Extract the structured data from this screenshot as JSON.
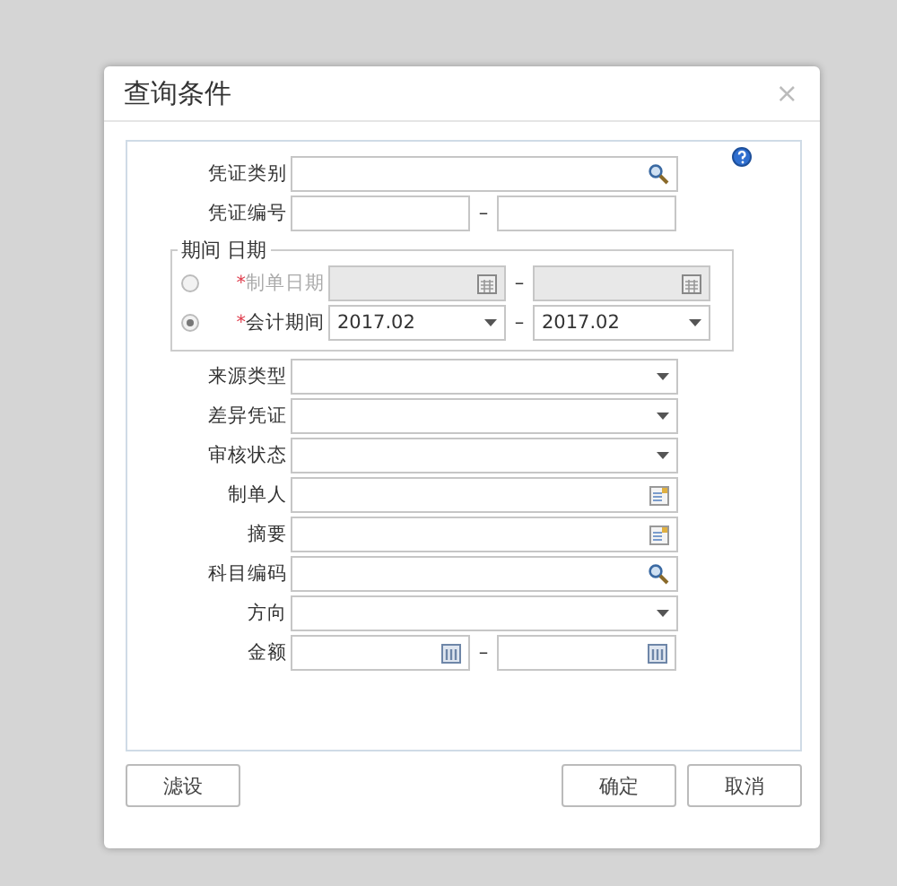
{
  "dialog": {
    "title": "查询条件",
    "close": "×"
  },
  "fields_top": [
    {
      "label": "凭证类别",
      "kind": "lookup"
    },
    {
      "label": "凭证编号",
      "kind": "text-range",
      "separator": "–"
    }
  ],
  "date_group": {
    "title": "期间 日期",
    "options": [
      {
        "label": "制单日期",
        "required_mark": "*",
        "selected": false,
        "disabled": true,
        "kind": "date",
        "separator": "–"
      },
      {
        "label": "会计期间",
        "required_mark": "*",
        "selected": true,
        "disabled": false,
        "kind": "period",
        "from": "2017.02",
        "to": "2017.02",
        "separator": "–"
      }
    ]
  },
  "fields": [
    {
      "label": "来源类型",
      "kind": "select"
    },
    {
      "label": "差异凭证",
      "kind": "select"
    },
    {
      "label": "审核状态",
      "kind": "select"
    },
    {
      "label": "制单人",
      "kind": "picker"
    },
    {
      "label": "摘要",
      "kind": "picker"
    },
    {
      "label": "科目编码",
      "kind": "lookup"
    },
    {
      "label": "方向",
      "kind": "select"
    },
    {
      "label": "金额",
      "kind": "number-range",
      "separator": "–"
    }
  ],
  "buttons": [
    {
      "label": "滤设",
      "kind": "left"
    },
    {
      "label": "确定",
      "kind": "right"
    },
    {
      "label": "取消",
      "kind": "right"
    }
  ]
}
